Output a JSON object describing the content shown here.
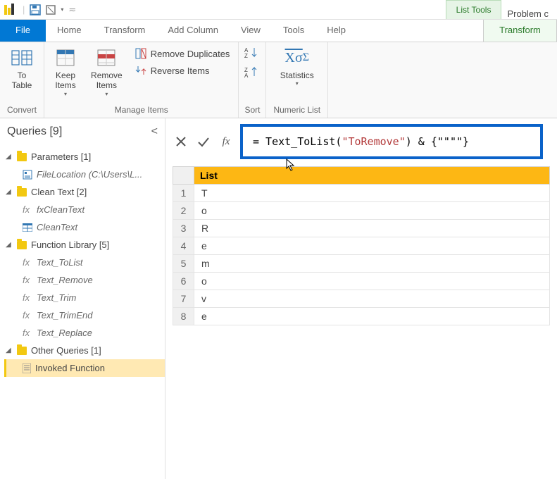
{
  "window": {
    "title_suffix": "Problem c",
    "context_tab": "List Tools"
  },
  "tabs": {
    "file": "File",
    "home": "Home",
    "transform": "Transform",
    "add_column": "Add Column",
    "view": "View",
    "tools": "Tools",
    "help": "Help",
    "context_transform": "Transform"
  },
  "ribbon": {
    "convert": {
      "group": "Convert",
      "to_table": "To\nTable"
    },
    "manage": {
      "group": "Manage Items",
      "keep_items": "Keep\nItems",
      "remove_items": "Remove\nItems",
      "remove_duplicates": "Remove Duplicates",
      "reverse_items": "Reverse Items"
    },
    "sort": {
      "group": "Sort"
    },
    "numeric": {
      "group": "Numeric List",
      "statistics": "Statistics"
    }
  },
  "queries": {
    "title": "Queries [9]",
    "groups": {
      "parameters": {
        "label": "Parameters [1]",
        "items": [
          {
            "label": "FileLocation (C:\\Users\\L..."
          }
        ]
      },
      "clean_text": {
        "label": "Clean Text [2]",
        "items": [
          {
            "label": "fxCleanText",
            "kind": "fx"
          },
          {
            "label": "CleanText",
            "kind": "table"
          }
        ]
      },
      "fn_lib": {
        "label": "Function Library [5]",
        "items": [
          {
            "label": "Text_ToList",
            "kind": "fx"
          },
          {
            "label": "Text_Remove",
            "kind": "fx"
          },
          {
            "label": "Text_Trim",
            "kind": "fx"
          },
          {
            "label": "Text_TrimEnd",
            "kind": "fx"
          },
          {
            "label": "Text_Replace",
            "kind": "fx"
          }
        ]
      },
      "other": {
        "label": "Other Queries [1]",
        "items": [
          {
            "label": "Invoked Function",
            "kind": "list",
            "selected": true
          }
        ]
      }
    }
  },
  "formula": {
    "prefix": "= Text_ToList(",
    "string": "\"ToRemove\"",
    "suffix": ") & {\"\"\"\"}"
  },
  "list": {
    "header": "List",
    "rows": [
      {
        "n": "1",
        "v": "T"
      },
      {
        "n": "2",
        "v": "o"
      },
      {
        "n": "3",
        "v": "R"
      },
      {
        "n": "4",
        "v": "e"
      },
      {
        "n": "5",
        "v": "m"
      },
      {
        "n": "6",
        "v": "o"
      },
      {
        "n": "7",
        "v": "v"
      },
      {
        "n": "8",
        "v": "e"
      }
    ]
  }
}
